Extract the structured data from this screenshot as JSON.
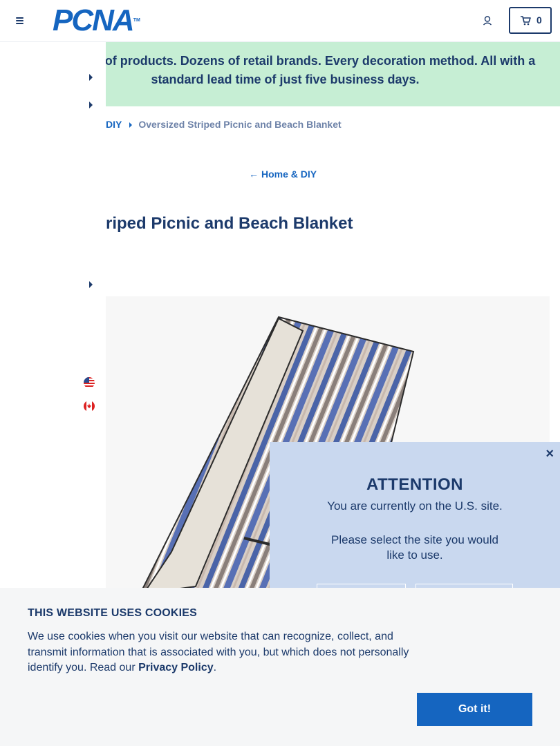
{
  "header": {
    "logo_text": "PCNA",
    "logo_tm": "TM",
    "cart_count": "0",
    "brand_color": "#1565c0",
    "text_color": "#1c3a6b"
  },
  "banner": {
    "text": "Thousands of products. Dozens of retail brands. Every decoration method. All with a standard lead time of just five business days.",
    "color": "#c6eed4"
  },
  "breadcrumb": {
    "parent": "DIY",
    "current": "Oversized Striped Picnic and Beach Blanket"
  },
  "back_link": {
    "arrow": "←",
    "label": "Home & DIY"
  },
  "product": {
    "title": "Oversized Striped Picnic and Beach Blanket",
    "visible_title": "triped Picnic and Beach Blanket"
  },
  "attention": {
    "title": "ATTENTION",
    "line1": "You are currently on the U.S. site.",
    "line2": "Please select the site you would like to use.",
    "close": "×"
  },
  "cookie": {
    "title": "THIS WEBSITE USES COOKIES",
    "body": "We use cookies when you visit our website that can recognize, collect, and transmit information that is associated with you, but which does not personally identify you. Read our ",
    "link": "Privacy Policy",
    "end": ".",
    "button": "Got it!"
  }
}
